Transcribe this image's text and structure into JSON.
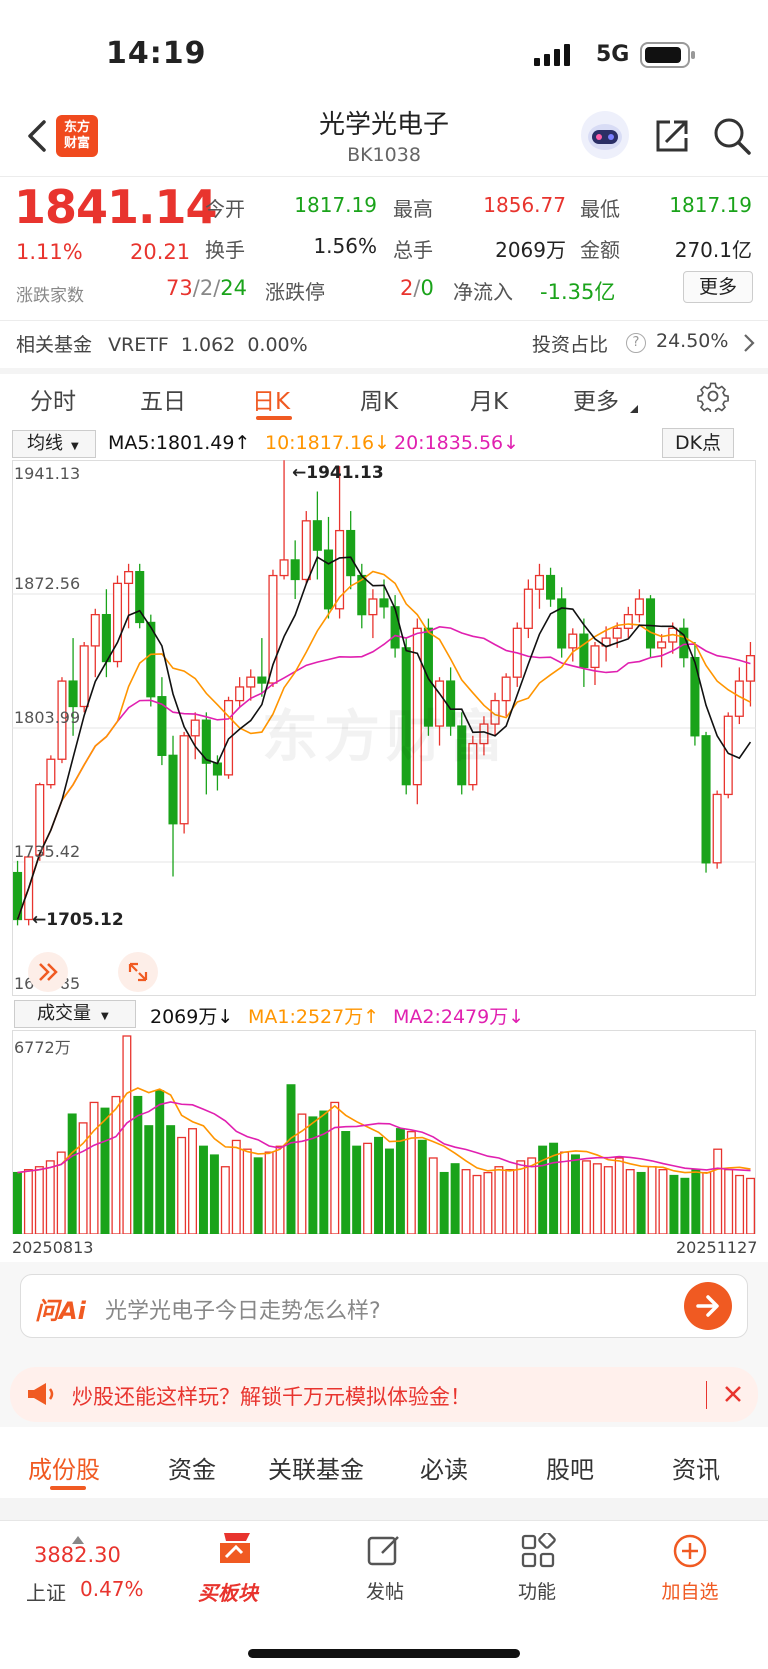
{
  "status_bar": {
    "time": "14:19",
    "network": "5G"
  },
  "header": {
    "title": "光学光电子",
    "code": "BK1038",
    "logo_line1": "东方",
    "logo_line2": "财富"
  },
  "quote": {
    "price": "1841.14",
    "change_pct": "1.11%",
    "change_abs": "20.21",
    "open_label": "今开",
    "open": "1817.19",
    "high_label": "最高",
    "high": "1856.77",
    "low_label": "最低",
    "low": "1817.19",
    "turnover_label": "换手",
    "turnover": "1.56%",
    "volume_label": "总手",
    "volume": "2069万",
    "amount_label": "金额",
    "amount": "270.1亿",
    "breadth_label": "涨跌家数",
    "up": "73",
    "flat": "2",
    "down": "24",
    "limit_label": "涨跌停",
    "limit_up": "2",
    "limit_down": "0",
    "netflow_label": "净流入",
    "netflow": "-1.35亿",
    "more_label": "更多"
  },
  "fund": {
    "label": "相关基金",
    "name": "VRETF",
    "price": "1.062",
    "pct": "0.00%",
    "ratio_label": "投资占比",
    "ratio": "24.50%"
  },
  "period_tabs": [
    "分时",
    "五日",
    "日K",
    "周K",
    "月K",
    "更多"
  ],
  "active_period": "日K",
  "indicator": {
    "ma_select": "均线",
    "ma5": "MA5:1801.49↑",
    "ma10": "10:1817.16↓",
    "ma20": "20:1835.56↓",
    "dk_label": "DK点",
    "y_ticks": [
      "1941.13",
      "1872.56",
      "1803.99",
      "1735.42",
      "1666.85"
    ],
    "max_label": "←1941.13",
    "min_label": "←1705.12",
    "watermark": "东方财富"
  },
  "volume_panel": {
    "select": "成交量",
    "current": "2069万↓",
    "ma1": "MA1:2527万↑",
    "ma2": "MA2:2479万↓",
    "max_tick": "6772万",
    "date_start": "20250813",
    "date_end": "20251127"
  },
  "colors": {
    "up": "#e8342e",
    "down": "#1aa31a",
    "ma5": "#111111",
    "ma10": "#ff9500",
    "ma20": "#e020b0",
    "accent": "#f05a22"
  },
  "ai": {
    "brand": "问Ai",
    "placeholder": "光学光电子今日走势怎么样?"
  },
  "promo": {
    "text": "炒股还能这样玩？解锁千万元模拟体验金！"
  },
  "sub_tabs": [
    "成份股",
    "资金",
    "关联基金",
    "必读",
    "股吧",
    "资讯"
  ],
  "active_sub_tab": "成份股",
  "bottom_nav": {
    "index_value": "3882.30",
    "index_name": "上证",
    "index_pct": "0.47%",
    "buy_label": "买板块",
    "post_label": "发帖",
    "func_label": "功能",
    "add_label": "加自选"
  },
  "chart_data": {
    "type": "candlestick",
    "ylim": [
      1666.85,
      1941.13
    ],
    "candles": [
      {
        "o": 1730,
        "h": 1736,
        "l": 1703,
        "c": 1706
      },
      {
        "o": 1706,
        "h": 1739,
        "l": 1703,
        "c": 1738
      },
      {
        "o": 1739,
        "h": 1776,
        "l": 1736,
        "c": 1775
      },
      {
        "o": 1775,
        "h": 1790,
        "l": 1773,
        "c": 1788
      },
      {
        "o": 1788,
        "h": 1830,
        "l": 1786,
        "c": 1828
      },
      {
        "o": 1828,
        "h": 1850,
        "l": 1800,
        "c": 1815
      },
      {
        "o": 1815,
        "h": 1848,
        "l": 1812,
        "c": 1846
      },
      {
        "o": 1846,
        "h": 1865,
        "l": 1830,
        "c": 1862
      },
      {
        "o": 1862,
        "h": 1875,
        "l": 1830,
        "c": 1838
      },
      {
        "o": 1838,
        "h": 1882,
        "l": 1835,
        "c": 1878
      },
      {
        "o": 1878,
        "h": 1888,
        "l": 1855,
        "c": 1884
      },
      {
        "o": 1884,
        "h": 1888,
        "l": 1855,
        "c": 1858
      },
      {
        "o": 1858,
        "h": 1862,
        "l": 1815,
        "c": 1820
      },
      {
        "o": 1820,
        "h": 1830,
        "l": 1785,
        "c": 1790
      },
      {
        "o": 1790,
        "h": 1800,
        "l": 1728,
        "c": 1755
      },
      {
        "o": 1755,
        "h": 1802,
        "l": 1750,
        "c": 1800
      },
      {
        "o": 1800,
        "h": 1812,
        "l": 1788,
        "c": 1808
      },
      {
        "o": 1808,
        "h": 1812,
        "l": 1770,
        "c": 1786
      },
      {
        "o": 1786,
        "h": 1790,
        "l": 1772,
        "c": 1780
      },
      {
        "o": 1780,
        "h": 1820,
        "l": 1778,
        "c": 1818
      },
      {
        "o": 1818,
        "h": 1830,
        "l": 1815,
        "c": 1825
      },
      {
        "o": 1825,
        "h": 1834,
        "l": 1818,
        "c": 1830
      },
      {
        "o": 1830,
        "h": 1850,
        "l": 1820,
        "c": 1827
      },
      {
        "o": 1827,
        "h": 1885,
        "l": 1825,
        "c": 1882
      },
      {
        "o": 1882,
        "h": 1941,
        "l": 1880,
        "c": 1890
      },
      {
        "o": 1890,
        "h": 1900,
        "l": 1870,
        "c": 1880
      },
      {
        "o": 1880,
        "h": 1915,
        "l": 1878,
        "c": 1910
      },
      {
        "o": 1910,
        "h": 1925,
        "l": 1880,
        "c": 1895
      },
      {
        "o": 1895,
        "h": 1912,
        "l": 1860,
        "c": 1865
      },
      {
        "o": 1865,
        "h": 1938,
        "l": 1860,
        "c": 1905
      },
      {
        "o": 1905,
        "h": 1915,
        "l": 1875,
        "c": 1882
      },
      {
        "o": 1882,
        "h": 1888,
        "l": 1855,
        "c": 1862
      },
      {
        "o": 1862,
        "h": 1875,
        "l": 1850,
        "c": 1870
      },
      {
        "o": 1870,
        "h": 1880,
        "l": 1860,
        "c": 1866
      },
      {
        "o": 1866,
        "h": 1872,
        "l": 1840,
        "c": 1845
      },
      {
        "o": 1845,
        "h": 1850,
        "l": 1770,
        "c": 1775
      },
      {
        "o": 1775,
        "h": 1860,
        "l": 1765,
        "c": 1855
      },
      {
        "o": 1855,
        "h": 1860,
        "l": 1800,
        "c": 1805
      },
      {
        "o": 1805,
        "h": 1830,
        "l": 1795,
        "c": 1828
      },
      {
        "o": 1828,
        "h": 1835,
        "l": 1800,
        "c": 1805
      },
      {
        "o": 1805,
        "h": 1812,
        "l": 1770,
        "c": 1775
      },
      {
        "o": 1775,
        "h": 1800,
        "l": 1772,
        "c": 1796
      },
      {
        "o": 1796,
        "h": 1810,
        "l": 1790,
        "c": 1806
      },
      {
        "o": 1806,
        "h": 1822,
        "l": 1800,
        "c": 1818
      },
      {
        "o": 1818,
        "h": 1832,
        "l": 1810,
        "c": 1830
      },
      {
        "o": 1830,
        "h": 1858,
        "l": 1825,
        "c": 1855
      },
      {
        "o": 1855,
        "h": 1880,
        "l": 1850,
        "c": 1875
      },
      {
        "o": 1875,
        "h": 1888,
        "l": 1865,
        "c": 1882
      },
      {
        "o": 1882,
        "h": 1886,
        "l": 1866,
        "c": 1870
      },
      {
        "o": 1870,
        "h": 1876,
        "l": 1840,
        "c": 1845
      },
      {
        "o": 1845,
        "h": 1855,
        "l": 1838,
        "c": 1852
      },
      {
        "o": 1852,
        "h": 1860,
        "l": 1825,
        "c": 1835
      },
      {
        "o": 1835,
        "h": 1848,
        "l": 1826,
        "c": 1846
      },
      {
        "o": 1846,
        "h": 1856,
        "l": 1838,
        "c": 1850
      },
      {
        "o": 1850,
        "h": 1858,
        "l": 1845,
        "c": 1855
      },
      {
        "o": 1855,
        "h": 1866,
        "l": 1850,
        "c": 1862
      },
      {
        "o": 1862,
        "h": 1875,
        "l": 1858,
        "c": 1870
      },
      {
        "o": 1870,
        "h": 1872,
        "l": 1840,
        "c": 1845
      },
      {
        "o": 1845,
        "h": 1852,
        "l": 1835,
        "c": 1848
      },
      {
        "o": 1848,
        "h": 1858,
        "l": 1842,
        "c": 1855
      },
      {
        "o": 1855,
        "h": 1860,
        "l": 1835,
        "c": 1840
      },
      {
        "o": 1840,
        "h": 1848,
        "l": 1795,
        "c": 1800
      },
      {
        "o": 1800,
        "h": 1802,
        "l": 1730,
        "c": 1735
      },
      {
        "o": 1735,
        "h": 1772,
        "l": 1732,
        "c": 1770
      },
      {
        "o": 1770,
        "h": 1812,
        "l": 1768,
        "c": 1810
      },
      {
        "o": 1810,
        "h": 1835,
        "l": 1806,
        "c": 1828
      },
      {
        "o": 1828,
        "h": 1848,
        "l": 1815,
        "c": 1841
      }
    ]
  },
  "volume_data": [
    2100,
    2200,
    2300,
    2500,
    2800,
    4100,
    3800,
    4500,
    4300,
    4700,
    6772,
    4700,
    3700,
    4900,
    3700,
    3300,
    3600,
    3000,
    2700,
    2300,
    3200,
    2900,
    2600,
    2800,
    3000,
    5100,
    4100,
    4000,
    4200,
    4500,
    3500,
    3000,
    3100,
    3300,
    2900,
    3600,
    3500,
    3200,
    2600,
    2100,
    2400,
    2200,
    2000,
    2100,
    2300,
    2200,
    2500,
    2600,
    3000,
    3100,
    2800,
    2700,
    2500,
    2400,
    2300,
    2600,
    2200,
    2100,
    2300,
    2200,
    2000,
    1900,
    2200,
    2100,
    2900,
    2200,
    2000,
    1900
  ]
}
